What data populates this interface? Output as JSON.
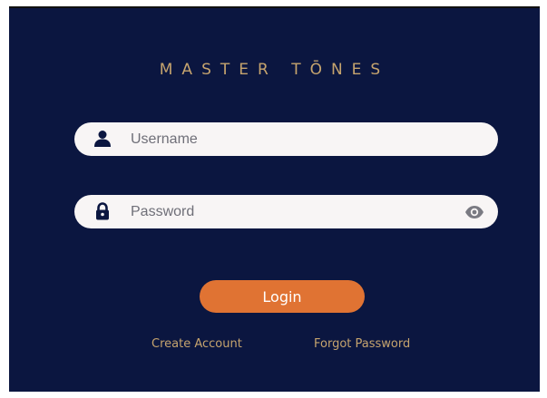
{
  "brand": {
    "title": "MASTER TŌNES",
    "color": "#c6a46e"
  },
  "form": {
    "username": {
      "placeholder": "Username",
      "value": "",
      "icon": "user-icon"
    },
    "password": {
      "placeholder": "Password",
      "value": "",
      "icon": "lock-icon",
      "toggle_icon": "eye-icon"
    },
    "login_label": "Login"
  },
  "links": {
    "create_account": "Create Account",
    "forgot_password": "Forgot Password"
  },
  "colors": {
    "background": "#0b1640",
    "field_background": "#f8f5f5",
    "accent": "#e07333",
    "link": "#c6a46e"
  }
}
